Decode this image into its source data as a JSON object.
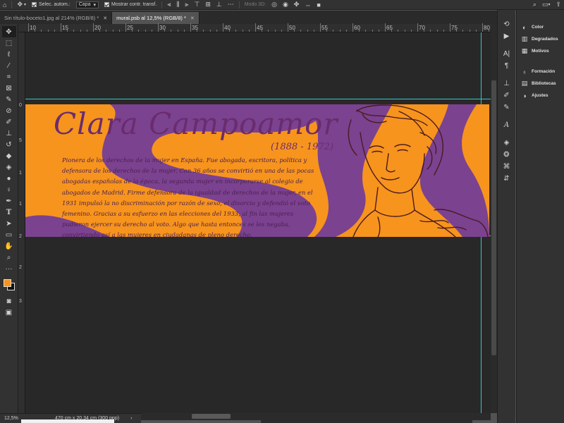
{
  "options_bar": {
    "auto_select_label": "Selec. autom.:",
    "layer_select": "Capa",
    "show_transform_label": "Mostrar contr. transf.",
    "mode_3d_label": "Modo 3D:"
  },
  "tabs": [
    {
      "label": "Sin título-boceto1.jpg al 214% (RGB/8) *",
      "active": false
    },
    {
      "label": "mural.psb al 12,5% (RGB/8) *",
      "active": true
    }
  ],
  "ruler": {
    "h_numbers": [
      "10",
      "15",
      "20",
      "25",
      "30",
      "35",
      "40",
      "45",
      "50",
      "55",
      "60",
      "65",
      "70",
      "75",
      "80"
    ],
    "v_numbers": [
      "0",
      "5",
      "1",
      "1",
      "2",
      "2",
      "3"
    ]
  },
  "artwork": {
    "title": "Clara Campoamor",
    "years": "(1888 - 1972)",
    "body": "Pionera de los derechos de la mujer en España. Fue abogada, escritora, política y defensora de los derechos de la mujer. Con 36 años se convirtió en una de las pocas abogadas españolas de la época, la segunda mujer en incorporarse al colegio de abogados de Madrid. Firme defensora de la igualdad de derechos de la mujer, en el 1931 impulsó la no discriminación por razón de sexo, el divorcio y defendió el voto femenino. Gracias a su esfuerzo en las elecciones del 1933, al fin las mujeres pudieron ejercer su derecho al voto. Algo que hasta entonces se les negaba, convirtiendo así a las mujeres en ciudadanas de pleno derecho.",
    "colors": {
      "background": "#f7941d",
      "purple": "#7b4290",
      "title": "#6a2c6e"
    }
  },
  "status": {
    "zoom": "12,5%",
    "doc_info": "470 cm x 20,34 cm (300 ppp)"
  },
  "panel": {
    "items": [
      {
        "label": "Color",
        "icon": "color-wheel-icon"
      },
      {
        "label": "Degradados",
        "icon": "gradient-icon"
      },
      {
        "label": "Motivos",
        "icon": "pattern-icon"
      },
      {
        "label": "Formación",
        "icon": "lightbulb-icon"
      },
      {
        "label": "Bibliotecas",
        "icon": "libraries-icon"
      },
      {
        "label": "Ajustes",
        "icon": "adjustments-icon"
      }
    ]
  }
}
